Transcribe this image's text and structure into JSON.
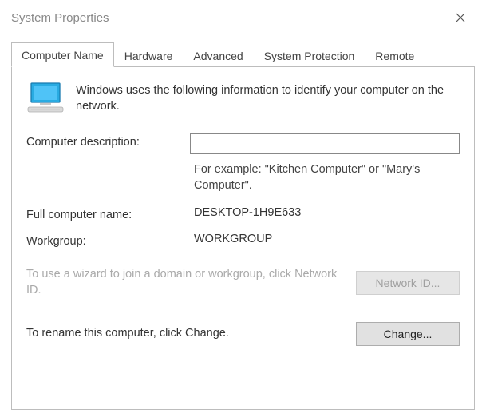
{
  "window": {
    "title": "System Properties"
  },
  "tabs": {
    "computer_name": "Computer Name",
    "hardware": "Hardware",
    "advanced": "Advanced",
    "system_protection": "System Protection",
    "remote": "Remote"
  },
  "content": {
    "intro": "Windows uses the following information to identify your computer on the network.",
    "description_label": "Computer description:",
    "description_value": "",
    "description_hint": "For example: \"Kitchen Computer\" or \"Mary's Computer\".",
    "full_name_label": "Full computer name:",
    "full_name_value": "DESKTOP-1H9E633",
    "workgroup_label": "Workgroup:",
    "workgroup_value": "WORKGROUP",
    "network_id_text": "To use a wizard to join a domain or workgroup, click Network ID.",
    "network_id_button": "Network ID...",
    "rename_text": "To rename this computer, click Change.",
    "change_button": "Change..."
  }
}
